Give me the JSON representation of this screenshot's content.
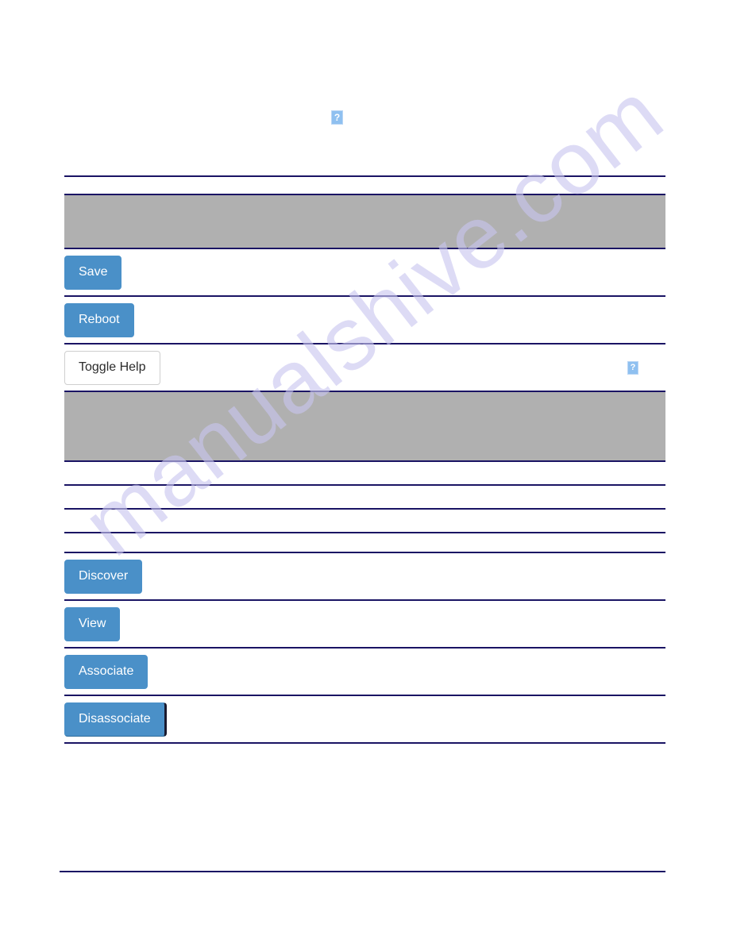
{
  "page": {
    "background_color": "#ffffff",
    "accent_color": "#4a90c8",
    "rule_color": "#1a1464",
    "band_color": "#b0b0b0"
  },
  "watermark": {
    "text": "manualshive.com",
    "color": "#c9c6ef"
  },
  "top_area": {
    "help_icon_label": "?"
  },
  "table": {
    "rows": [
      {
        "kind": "band",
        "label": ""
      },
      {
        "kind": "button",
        "button_label": "Save",
        "style": "primary"
      },
      {
        "kind": "button",
        "button_label": "Reboot",
        "style": "primary"
      },
      {
        "kind": "button_help",
        "button_label": "Toggle Help",
        "style": "default",
        "help_icon_label": "?"
      },
      {
        "kind": "band_tall",
        "label": ""
      },
      {
        "kind": "empty",
        "label": ""
      },
      {
        "kind": "empty",
        "label": ""
      },
      {
        "kind": "empty",
        "label": ""
      },
      {
        "kind": "empty",
        "label": ""
      },
      {
        "kind": "button",
        "button_label": "Discover",
        "style": "primary"
      },
      {
        "kind": "button",
        "button_label": "View",
        "style": "primary"
      },
      {
        "kind": "button",
        "button_label": "Associate",
        "style": "primary"
      },
      {
        "kind": "button",
        "button_label": "Disassociate",
        "style": "primary",
        "focused": true
      }
    ]
  },
  "buttons": {
    "save": "Save",
    "reboot": "Reboot",
    "toggle_help": "Toggle Help",
    "discover": "Discover",
    "view": "View",
    "associate": "Associate",
    "disassociate": "Disassociate"
  },
  "icons": {
    "help_placeholder": "?"
  }
}
